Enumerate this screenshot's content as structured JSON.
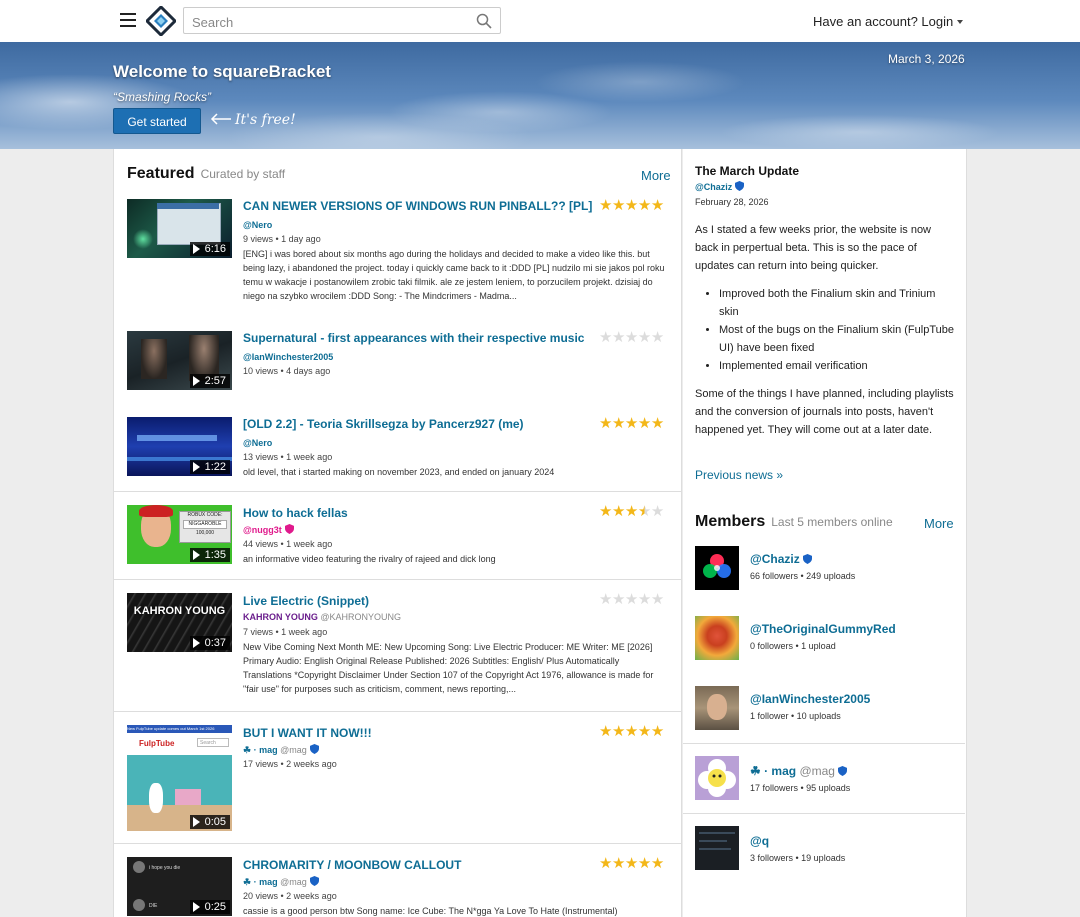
{
  "header": {
    "search_placeholder": "Search",
    "login_label": "Have an account? Login"
  },
  "banner": {
    "title": "Welcome to squareBracket",
    "tagline": "“Smashing Rocks”",
    "cta_label": "Get started",
    "free_note": "It's free!",
    "date": "March 3, 2026"
  },
  "featured": {
    "title": "Featured",
    "subtitle": "Curated by staff",
    "more_label": "More",
    "videos": [
      {
        "title": "CAN NEWER VERSIONS OF WINDOWS RUN PINBALL?? [PL]",
        "author": "@Nero",
        "meta": "9 views • 1 day ago",
        "duration": "6:16",
        "rating": 5,
        "desc": "[ENG] i was bored about six months ago during the holidays and decided to make a video like this. but being lazy, i abandoned the project. today i quickly came back to it :DDD [PL] nudzilo mi sie jakos pol roku temu w wakacje i postanowilem zrobic taki filmik. ale ze jestem leniem, to porzucilem projekt. dzisiaj do niego na szybko wrocilem :DDD Song: - The Mindcrimers - Madma..."
      },
      {
        "title": "Supernatural - first appearances with their respective music",
        "author": "@IanWinchester2005",
        "meta": "10 views • 4 days ago",
        "duration": "2:57",
        "rating": 0,
        "desc": ""
      },
      {
        "title": "[OLD 2.2] - Teoria Skrillsegza by Pancerz927 (me)",
        "author": "@Nero",
        "meta": "13 views • 1 week ago",
        "duration": "1:22",
        "rating": 5,
        "desc": "old level, that i started making on november 2023, and ended on january 2024"
      },
      {
        "title": "How to hack fellas",
        "author": "@nugg3t",
        "meta": "44 views • 1 week ago",
        "duration": "1:35",
        "rating": 3.5,
        "desc": "an informative video featuring the rivalry of rajeed and dick long",
        "thumb_text_1": "ROBUX CODE:",
        "thumb_text_2": "NIGGAROBLE",
        "thumb_text_3": "100,000"
      },
      {
        "title": "Live Electric (Snippet)",
        "author": "KAHRON YOUNG",
        "author_handle": "@KAHRONYOUNG",
        "meta": "7 views • 1 week ago",
        "duration": "0:37",
        "rating": 0,
        "desc": "New Vibe Coming Next Month ME: New Upcoming Song: Live Electric Producer: ME Writer: ME [2026] Primary Audio: English Original Release Published: 2026 Subtitles: English/ Plus Automatically Translations *Copyright Disclaimer Under Section 107 of the Copyright Act 1976, allowance is made for \"fair use\" for purposes such as criticism, comment, news reporting,...",
        "thumb_text": "KAHRON YOUNG"
      },
      {
        "title": "BUT I WANT IT NOW!!!",
        "author": "☘ · mag",
        "author_handle": "@mag",
        "meta": "17 views • 2 weeks ago",
        "duration": "0:05",
        "rating": 5,
        "desc": "",
        "thumb_text_1": "New FulpTube update comes out March 1st 2026",
        "thumb_text_2": "FulpTube",
        "thumb_text_3": "Search"
      },
      {
        "title": "CHROMARITY / MOONBOW CALLOUT",
        "author": "☘ · mag",
        "author_handle": "@mag",
        "meta": "20 views • 2 weeks ago",
        "duration": "0:25",
        "rating": 5,
        "desc": "cassie is a good person btw Song name: Ice Cube: The N*gga Ya Love To Hate (Instrumental)",
        "thumb_text_1": "i hope you die",
        "thumb_text_2": "DIE"
      }
    ]
  },
  "news": {
    "title": "The March Update",
    "author": "@Chaziz",
    "date": "February 28, 2026",
    "p1": "As I stated a few weeks prior, the website is now back in perpertual beta. This is so the pace of updates can return into being quicker.",
    "bullets": [
      "Improved both the Finalium skin and Trinium skin",
      "Most of the bugs on the Finalium skin (FulpTube UI) have been fixed",
      "Implemented email verification"
    ],
    "p2": "Some of the things I have planned, including playlists and the conversion of journals into posts, haven't happened yet. They will come out at a later date.",
    "previous_label": "Previous news »"
  },
  "members": {
    "title": "Members",
    "subtitle": "Last 5 members online",
    "more_label": "More",
    "list": [
      {
        "name": "@Chaziz",
        "stats": "66 followers • 249 uploads"
      },
      {
        "name": "@TheOriginalGummyRed",
        "stats": "0 followers • 1 upload"
      },
      {
        "name": "@IanWinchester2005",
        "stats": "1 follower • 10 uploads"
      },
      {
        "name": "☘ · mag",
        "handle": "@mag",
        "stats": "17 followers • 95 uploads"
      },
      {
        "name": "@q",
        "stats": "3 followers • 19 uploads"
      }
    ]
  },
  "colors": {
    "link": "#0e6d94",
    "star_on": "#f3b719",
    "star_off": "#dcdcdc",
    "button": "#1d6fb3",
    "nugg3t_badge": "#e01a8c",
    "verified_badge": "#1a62c5"
  }
}
